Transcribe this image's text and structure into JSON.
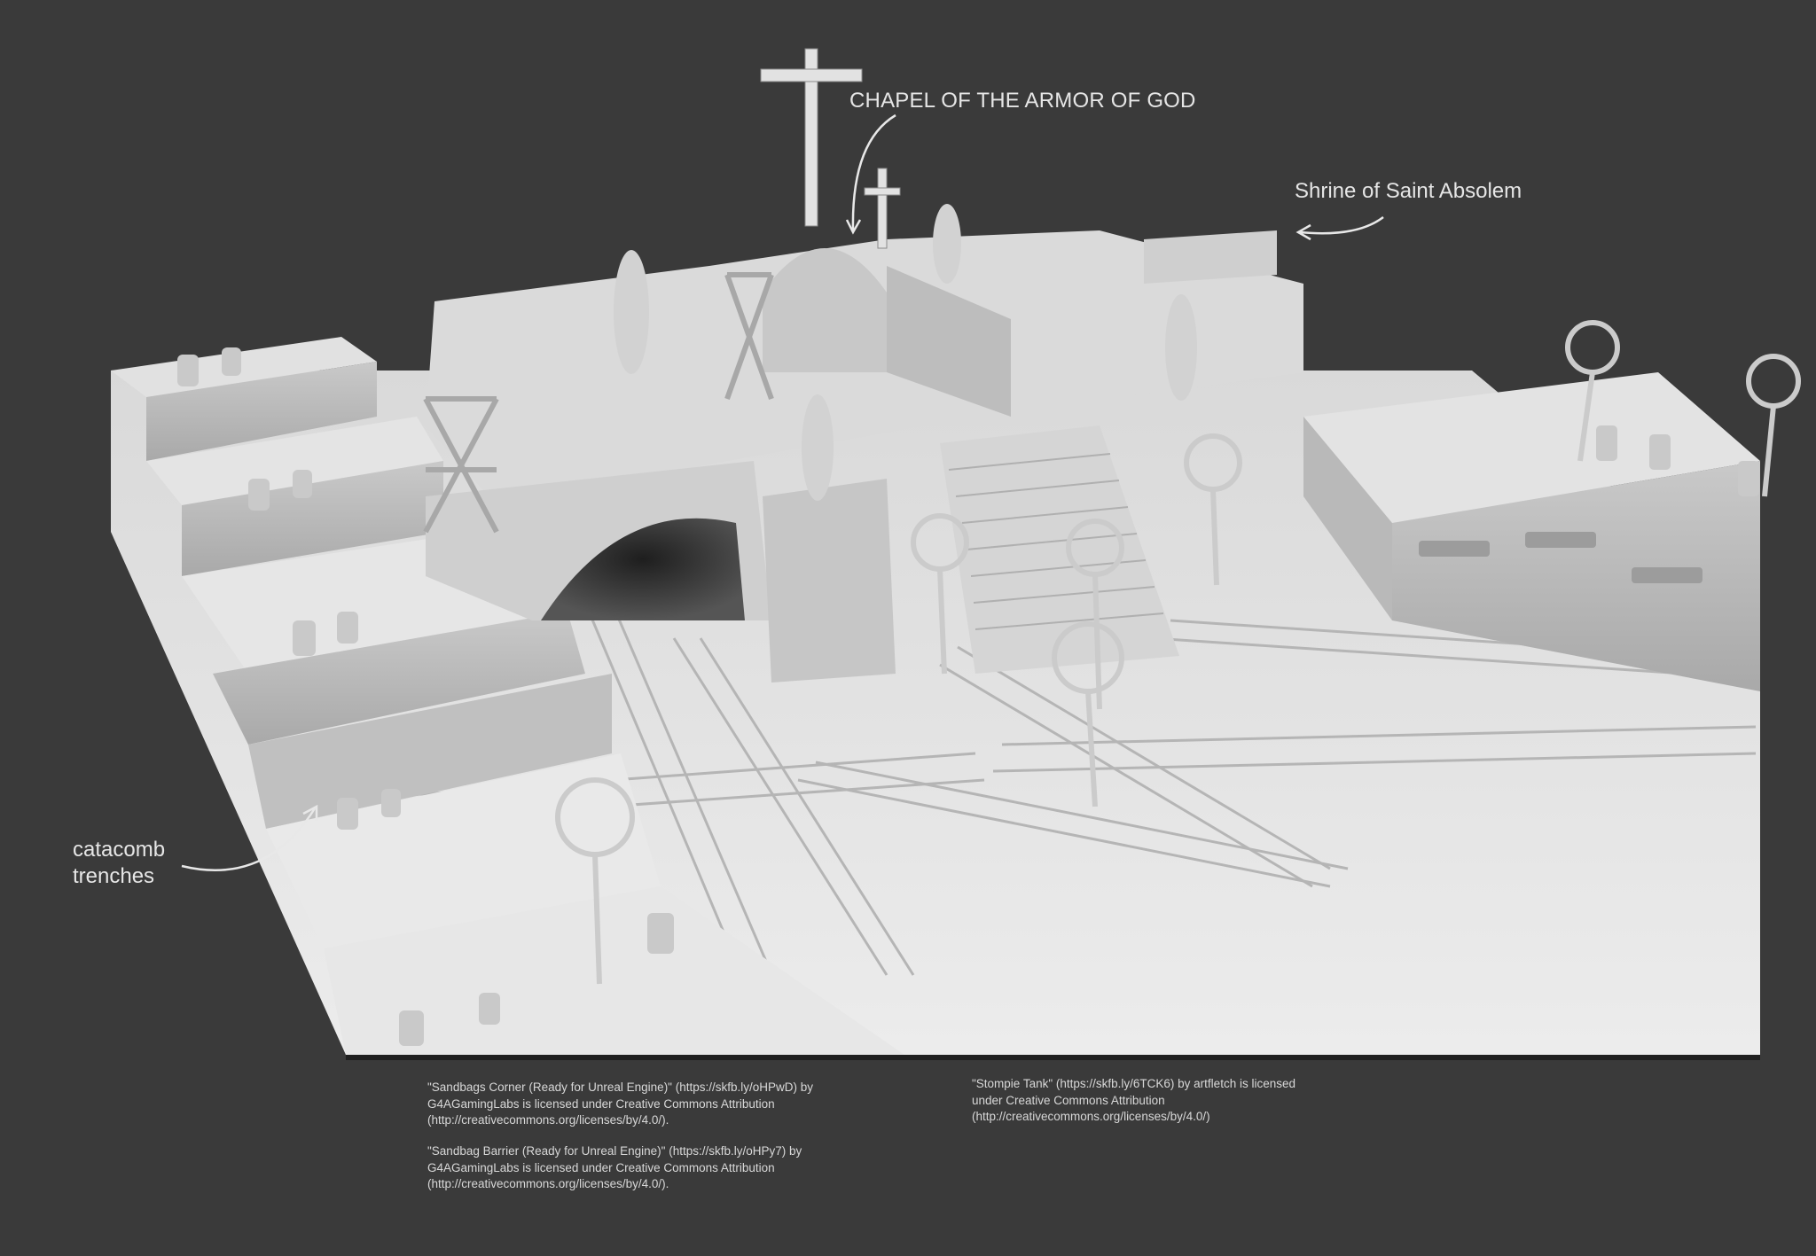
{
  "labels": {
    "chapel": "CHAPEL OF THE ARMOR OF GOD",
    "shrine": "Shrine of Saint Absolem",
    "catacomb": "catacomb trenches"
  },
  "credits": [
    "\"Sandbags Corner (Ready for Unreal Engine)\" (https://skfb.ly/oHPwD) by G4AGamingLabs is licensed under Creative Commons Attribution (http://creativecommons.org/licenses/by/4.0/).",
    "\"Sandbag Barrier (Ready for Unreal Engine)\" (https://skfb.ly/oHPy7) by G4AGamingLabs is licensed under Creative Commons Attribution (http://creativecommons.org/licenses/by/4.0/).",
    "\"Stompie Tank\" (https://skfb.ly/6TCK6) by artfletch is licensed under Creative Commons Attribution (http://creativecommons.org/licenses/by/4.0/)"
  ],
  "colors": {
    "background": "#3a3a3a",
    "model_light": "#dcdcdc",
    "model_mid": "#c4c4c4",
    "model_shadow": "#9a9a9a",
    "text": "#e6e6e6"
  }
}
